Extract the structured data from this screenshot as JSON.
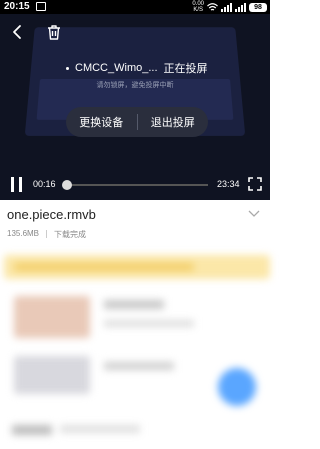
{
  "status_bar": {
    "time": "20:15",
    "net_speed_top": "0.00",
    "net_speed_bottom": "K/S",
    "battery": "98"
  },
  "cast": {
    "device_name": "CMCC_Wimo_...",
    "status": "正在投屏",
    "hint": "请勿锁屏，避免投屏中断",
    "change_device_label": "更换设备",
    "exit_cast_label": "退出投屏"
  },
  "player": {
    "current_time": "00:16",
    "total_time": "23:34",
    "progress": 0.011
  },
  "file": {
    "name": "one.piece.rmvb",
    "size": "135.6MB",
    "state": "下载完成"
  },
  "icons": {
    "back": "back-arrow-icon",
    "delete": "trash-icon",
    "pause": "pause-icon",
    "fullscreen": "fullscreen-icon",
    "expand": "chevron-down-icon"
  }
}
